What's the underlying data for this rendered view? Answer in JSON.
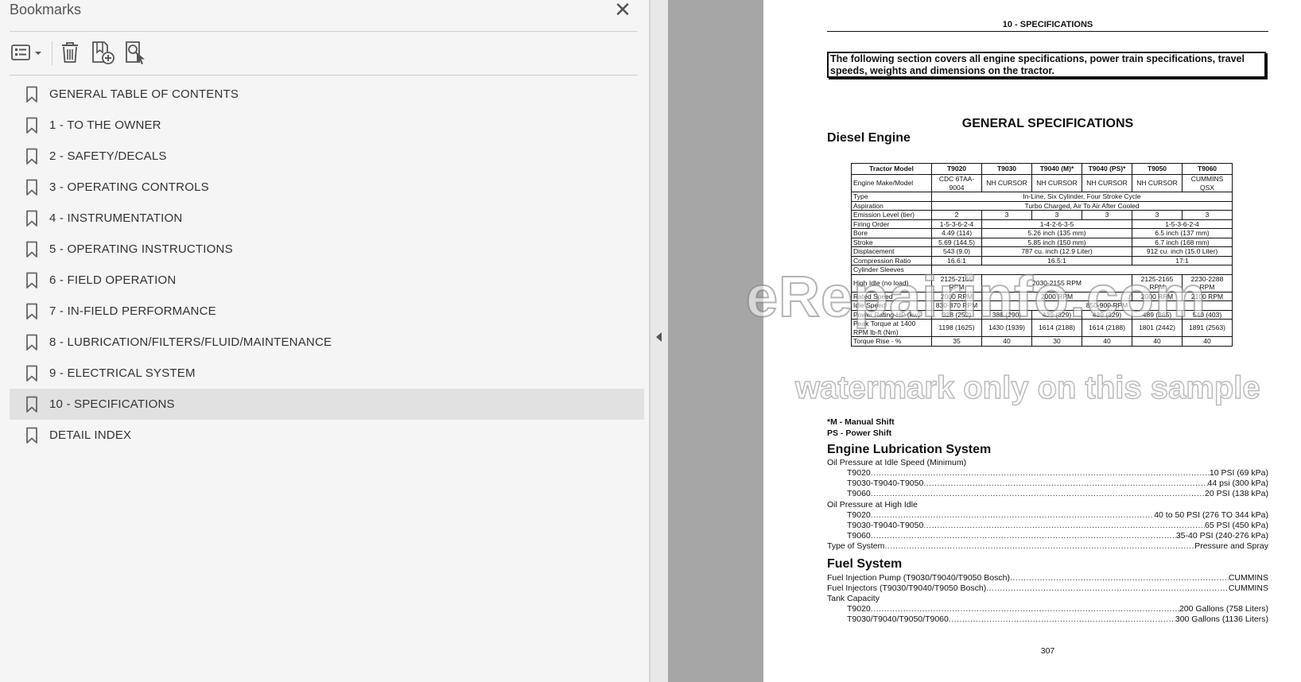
{
  "panel": {
    "title": "Bookmarks",
    "close_glyph": "✕"
  },
  "toolbar": {
    "options": "options-menu-icon",
    "delete": "trash-icon",
    "new_bookmark": "new-bookmark-icon",
    "find_bookmark": "find-current-bookmark-icon"
  },
  "bookmarks": [
    {
      "label": "GENERAL TABLE OF CONTENTS",
      "selected": false
    },
    {
      "label": "1 - TO THE OWNER",
      "selected": false
    },
    {
      "label": "2 - SAFETY/DECALS",
      "selected": false
    },
    {
      "label": "3 - OPERATING CONTROLS",
      "selected": false
    },
    {
      "label": "4 - INSTRUMENTATION",
      "selected": false
    },
    {
      "label": "5 - OPERATING INSTRUCTIONS",
      "selected": false
    },
    {
      "label": "6 - FIELD OPERATION",
      "selected": false
    },
    {
      "label": "7 - IN-FIELD PERFORMANCE",
      "selected": false
    },
    {
      "label": "8 - LUBRICATION/FILTERS/FLUID/MAINTENANCE",
      "selected": false
    },
    {
      "label": "9 - ELECTRICAL SYSTEM",
      "selected": false
    },
    {
      "label": "10 - SPECIFICATIONS",
      "selected": true
    },
    {
      "label": "DETAIL INDEX",
      "selected": false
    }
  ],
  "page": {
    "header": "10 - SPECIFICATIONS",
    "intro": "The following section covers all engine specifications, power train specifications, travel speeds, weights and dimensions on the tractor.",
    "title": "GENERAL SPECIFICATIONS",
    "diesel_heading": "Diesel Engine",
    "table": {
      "headers": [
        "Tractor Model",
        "T9020",
        "T9030",
        "T9040 (M)*",
        "T9040 (PS)*",
        "T9050",
        "T9060"
      ],
      "rows": [
        {
          "label": "Engine Make/Model",
          "cells": [
            {
              "t": "CDC 6TAA-9004"
            },
            {
              "t": "NH CURSOR"
            },
            {
              "t": "NH CURSOR"
            },
            {
              "t": "NH CURSOR"
            },
            {
              "t": "NH CURSOR"
            },
            {
              "t": "CUMMINS QSX"
            }
          ]
        },
        {
          "label": "Type",
          "cells": [
            {
              "t": "In-Line, Six Cylinder, Four Stroke Cycle",
              "span": 6
            }
          ]
        },
        {
          "label": "Aspiration",
          "cells": [
            {
              "t": "Turbo Charged, Air To Air After Cooled",
              "span": 6
            }
          ]
        },
        {
          "label": "Emission Level (tier)",
          "cells": [
            {
              "t": "2"
            },
            {
              "t": "3"
            },
            {
              "t": "3"
            },
            {
              "t": "3"
            },
            {
              "t": "3"
            },
            {
              "t": "3"
            }
          ]
        },
        {
          "label": "Firing Order",
          "cells": [
            {
              "t": "1-5-3-6-2-4"
            },
            {
              "t": "1-4-2-6-3-5",
              "span": 3
            },
            {
              "t": "1-5-3-6-2-4",
              "span": 2
            }
          ]
        },
        {
          "label": "Bore",
          "cells": [
            {
              "t": "4.49 (114)"
            },
            {
              "t": "5.26 inch (135 mm)",
              "span": 3
            },
            {
              "t": "6.5 inch (137 mm)",
              "span": 2
            }
          ]
        },
        {
          "label": "Stroke",
          "cells": [
            {
              "t": "5.69 (144.5)"
            },
            {
              "t": "5.85 inch (150 mm)",
              "span": 3
            },
            {
              "t": "6.7 inch (168 mm)",
              "span": 2
            }
          ]
        },
        {
          "label": "Displacement",
          "cells": [
            {
              "t": "543 (9.0)"
            },
            {
              "t": "787 cu. inch (12.9 Liter)",
              "span": 3
            },
            {
              "t": "912 cu. inch (15.0 Liter)",
              "span": 2
            }
          ]
        },
        {
          "label": "Compression Ratio",
          "cells": [
            {
              "t": "16.6:1"
            },
            {
              "t": "16.5:1",
              "span": 3
            },
            {
              "t": "17:1",
              "span": 2
            }
          ]
        },
        {
          "label": "Cylinder Sleeves",
          "cells": [
            {
              "t": "",
              "span": 6
            }
          ]
        },
        {
          "label": "High Idle (no load)",
          "cells": [
            {
              "t": "2125-2165 RPM"
            },
            {
              "t": "2030-2155 RPM",
              "span": 3
            },
            {
              "t": "2125-2165 RPM"
            },
            {
              "t": "2230-2288 RPM"
            }
          ]
        },
        {
          "label": "Rated Speed",
          "cells": [
            {
              "t": "2000 RPM"
            },
            {
              "t": "2000 RPM",
              "span": 3
            },
            {
              "t": "2000 RPM"
            },
            {
              "t": "2100 RPM"
            }
          ]
        },
        {
          "label": "Idle Speed",
          "cells": [
            {
              "t": "830-870 RPM"
            },
            {
              "t": "850-900 RPM",
              "span": 5
            }
          ]
        },
        {
          "label": "Power Rating-HP (kw)",
          "cells": [
            {
              "t": "328 (252)"
            },
            {
              "t": "388 (290)"
            },
            {
              "t": "439 (329)"
            },
            {
              "t": "439 (329)"
            },
            {
              "t": "489 (365)"
            },
            {
              "t": "540 (403)"
            }
          ]
        },
        {
          "label": "Peak Torque at 1400 RPM lb-ft (Nm)",
          "cells": [
            {
              "t": "1198 (1625)"
            },
            {
              "t": "1430 (1939)"
            },
            {
              "t": "1614 (2188)"
            },
            {
              "t": "1614 (2188)"
            },
            {
              "t": "1801 (2442)"
            },
            {
              "t": "1891 (2563)"
            }
          ]
        },
        {
          "label": "Torque Rise - %",
          "cells": [
            {
              "t": "35"
            },
            {
              "t": "40"
            },
            {
              "t": "30"
            },
            {
              "t": "40"
            },
            {
              "t": "40"
            },
            {
              "t": "40"
            }
          ]
        }
      ]
    },
    "note_m": "*M - Manual Shift",
    "note_ps": "PS - Power Shift",
    "lube_heading": "Engine Lubrication System",
    "lube_idle_label": "Oil Pressure at Idle Speed (Minimum)",
    "lube_idle": [
      {
        "k": "T9020",
        "v": "10 PSI (69 kPa)"
      },
      {
        "k": "T9030-T9040-T9050",
        "v": "44 psi (300 kPa)"
      },
      {
        "k": "T9060",
        "v": "20 PSI (138 kPa)"
      }
    ],
    "lube_high_label": "Oil Pressure at High Idle",
    "lube_high": [
      {
        "k": "T9020",
        "v": "40 to 50 PSI (276 TO 344 kPa)"
      },
      {
        "k": "T9030-T9040-T9050",
        "v": "65 PSI (450 kPa)"
      },
      {
        "k": "T9060",
        "v": "35-40 PSI (240-276 kPa)"
      }
    ],
    "lube_type": {
      "k": "Type of System",
      "v": "Pressure and Spray"
    },
    "fuel_heading": "Fuel System",
    "fuel_pump": {
      "k": "Fuel Injection Pump (T9030/T9040/T9050 Bosch)",
      "v": "CUMMINS"
    },
    "fuel_inj": {
      "k": "Fuel Injectors (T9030/T9040/T9050 Bosch)",
      "v": "CUMMINS"
    },
    "tank_label": "Tank Capacity",
    "tank": [
      {
        "k": "T9020",
        "v": "200 Gallons (758 Liters)"
      },
      {
        "k": "T9030/T9040/T9050/T9060",
        "v": "300 Gallons (1136 Liters)"
      }
    ],
    "page_number": "307"
  },
  "watermark": {
    "site": "eRepairinfo.com",
    "note": "watermark only on this sample"
  }
}
